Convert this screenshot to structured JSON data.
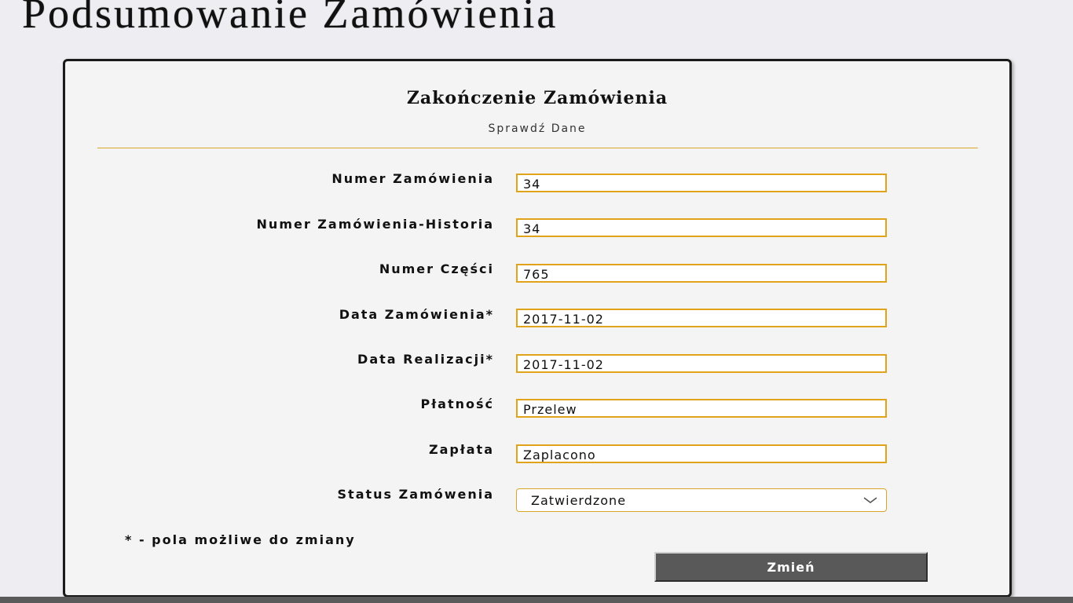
{
  "page": {
    "title": "Podsumowanie Zamówienia"
  },
  "form": {
    "heading": "Zakończenie Zamówienia",
    "subheading": "Sprawdź Dane",
    "fields": [
      {
        "label": "Numer Zamówienia",
        "value": "34"
      },
      {
        "label": "Numer Zamówienia-Historia",
        "value": "34"
      },
      {
        "label": "Numer Części",
        "value": "765"
      },
      {
        "label": "Data Zamówienia*",
        "value": "2017-11-02"
      },
      {
        "label": "Data Realizacji*",
        "value": "2017-11-02"
      },
      {
        "label": "Płatność",
        "value": "Przelew"
      },
      {
        "label": "Zapłata",
        "value": "Zaplacono"
      }
    ],
    "status": {
      "label": "Status Zamówenia",
      "selected": "Zatwierdzone"
    },
    "footnote": "* - pola możliwe do zmiany",
    "submit_label": "Zmień"
  },
  "colors": {
    "accent": "#e0a31a",
    "button": "#595959",
    "background": "#eeeef2",
    "panel": "#f4f4f4"
  },
  "icons": {
    "select_arrow": "chevron-down-icon"
  }
}
